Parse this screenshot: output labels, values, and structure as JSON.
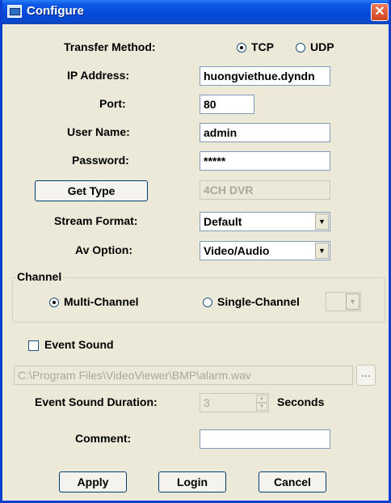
{
  "window": {
    "title": "Configure",
    "close_glyph": "✕"
  },
  "transfer": {
    "label": "Transfer Method:",
    "tcp": "TCP",
    "udp": "UDP"
  },
  "ip": {
    "label": "IP Address:",
    "value": "huongviethue.dyndn"
  },
  "port": {
    "label": "Port:",
    "value": "80"
  },
  "user": {
    "label": "User Name:",
    "value": "admin"
  },
  "password": {
    "label": "Password:",
    "value": "*****"
  },
  "get_type": {
    "button": "Get Type",
    "value": "4CH DVR"
  },
  "stream": {
    "label": "Stream Format:",
    "value": "Default"
  },
  "av": {
    "label": "Av Option:",
    "value": "Video/Audio"
  },
  "channel": {
    "title": "Channel",
    "multi": "Multi-Channel",
    "single": "Single-Channel"
  },
  "event": {
    "label": "Event Sound",
    "path": "C:\\Program Files\\VideoViewer\\BMP\\alarm.wav",
    "browse": "...",
    "duration_label": "Event Sound Duration:",
    "duration_value": "3",
    "seconds": "Seconds"
  },
  "comment": {
    "label": "Comment:",
    "value": ""
  },
  "buttons": {
    "apply": "Apply",
    "login": "Login",
    "cancel": "Cancel"
  },
  "icons": {
    "dropdown": "▼",
    "spin_up": "▲",
    "spin_down": "▼"
  }
}
